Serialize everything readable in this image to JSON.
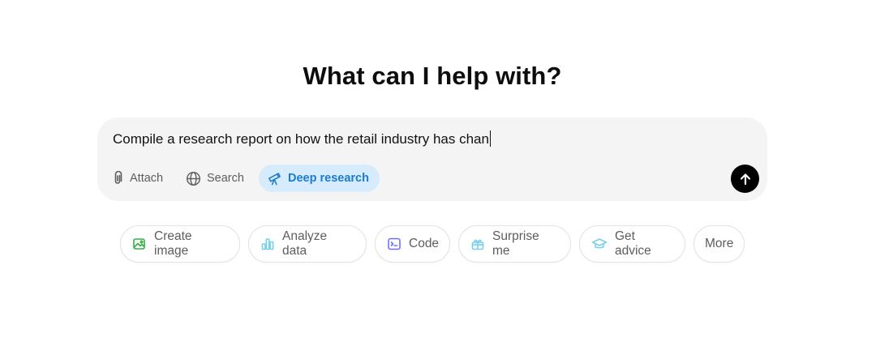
{
  "headline": "What can I help with?",
  "composer": {
    "text": "Compile a research report on how the retail industry has chan",
    "tools": {
      "attach_label": "Attach",
      "search_label": "Search",
      "deep_research_label": "Deep research"
    },
    "active_tool": "deep-research",
    "send_icon": "arrow-up-icon"
  },
  "suggestions": [
    {
      "label": "Create image",
      "icon": "image-icon",
      "color": "#35ae47"
    },
    {
      "label": "Analyze data",
      "icon": "bar-chart-icon",
      "color": "#76d0eb"
    },
    {
      "label": "Code",
      "icon": "terminal-icon",
      "color": "#6c71ff"
    },
    {
      "label": "Surprise me",
      "icon": "gift-icon",
      "color": "#76d0eb"
    },
    {
      "label": "Get advice",
      "icon": "graduation-cap-icon",
      "color": "#76d0eb"
    },
    {
      "label": "More",
      "icon": "",
      "color": ""
    }
  ],
  "colors": {
    "deep_research_bg": "#d6ebfb",
    "deep_research_fg": "#1a7bd1",
    "composer_bg": "#f4f4f4",
    "send_bg": "#000000"
  }
}
